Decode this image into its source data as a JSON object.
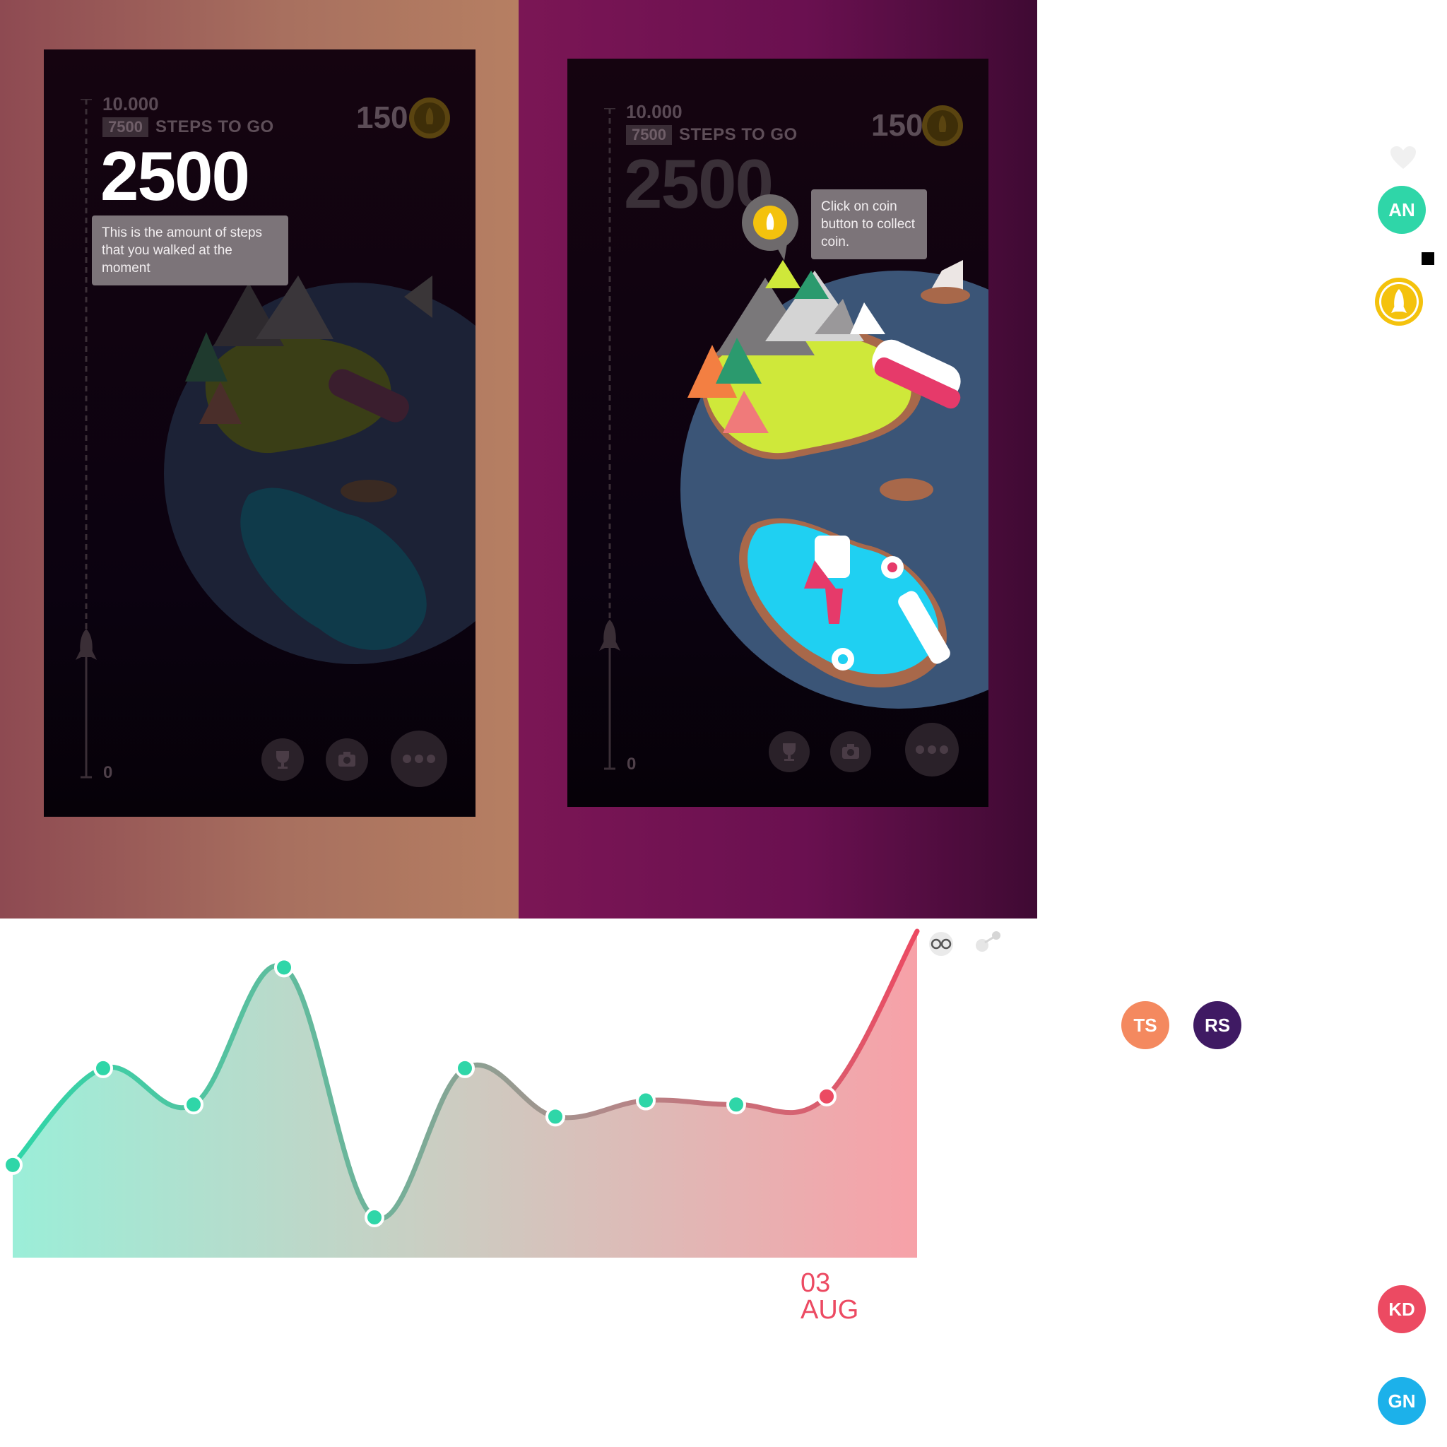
{
  "screens": [
    {
      "total_steps": "10.000",
      "to_go_value": "7500",
      "to_go_label": "STEPS TO GO",
      "steps": "2500",
      "zero": "0",
      "coins": "150",
      "tooltip": "This is the amount of steps that you walked at the moment"
    },
    {
      "total_steps": "10.000",
      "to_go_value": "7500",
      "to_go_label": "STEPS TO GO",
      "steps": "2500",
      "zero": "0",
      "coins": "150",
      "tooltip": "Click on coin button to collect coin."
    }
  ],
  "toolbar_icons": [
    "trophy-icon",
    "camera-icon",
    "more-icon"
  ],
  "colors": {
    "teal": "#2fd6a8",
    "red": "#ec4a62",
    "coin": "#f4c20d"
  },
  "avatars": [
    {
      "initials": "AN",
      "color": "#2fd6a8"
    },
    {
      "initials": "TS",
      "color": "#f4895f"
    },
    {
      "initials": "RS",
      "color": "#3f1a63"
    },
    {
      "initials": "KD",
      "color": "#ec4a62"
    },
    {
      "initials": "GN",
      "color": "#1cb1ea"
    }
  ],
  "chart_data": {
    "type": "area",
    "title": "",
    "xlabel": "",
    "ylabel": "",
    "x": [
      1,
      2,
      3,
      4,
      5,
      6,
      7,
      8,
      9,
      10,
      11
    ],
    "values": [
      23,
      47,
      38,
      72,
      10,
      47,
      35,
      39,
      38,
      40,
      81
    ],
    "highlight_label_day": "03",
    "highlight_label_month": "AUG",
    "highlight_index": 9
  }
}
